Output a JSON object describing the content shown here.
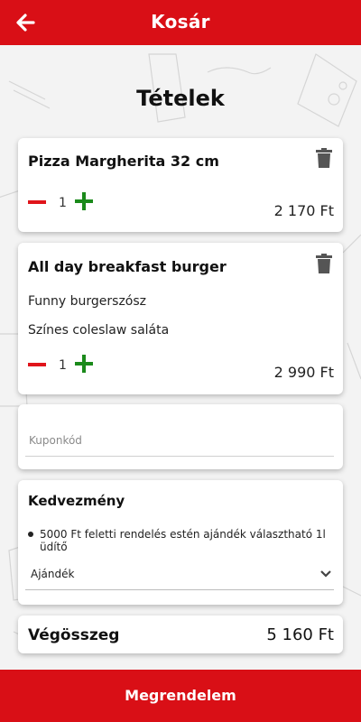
{
  "header": {
    "title": "Kosár",
    "back_icon": "arrow-left-icon"
  },
  "section": {
    "title": "Tételek"
  },
  "items": [
    {
      "name": "Pizza Margherita 32 cm",
      "quantity": "1",
      "price": "2 170 Ft",
      "extras": []
    },
    {
      "name": "All day breakfast burger",
      "quantity": "1",
      "price": "2 990 Ft",
      "extras": [
        "Funny burgerszósz",
        "Színes coleslaw saláta"
      ]
    }
  ],
  "coupon": {
    "placeholder": "Kuponkód",
    "value": ""
  },
  "discount": {
    "title": "Kedvezmény",
    "text": "5000 Ft feletti rendelés estén ajándék választható 1l üdítő",
    "selected": "Ajándék"
  },
  "total": {
    "label": "Végösszeg",
    "value": "5 160 Ft"
  },
  "order_button": {
    "label": "Megrendelem"
  },
  "colors": {
    "brand_red": "#d90f16",
    "minus_red": "#e0141b",
    "plus_green": "#1b8a1b"
  }
}
